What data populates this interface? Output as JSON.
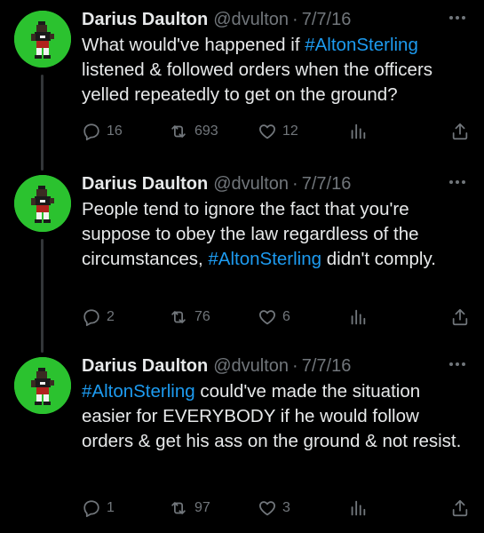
{
  "colors": {
    "background": "#000000",
    "text": "#e7e9ea",
    "muted": "#71767b",
    "link": "#1d9bf0",
    "avatar_bg": "#2bc22f",
    "thread_line": "#333639"
  },
  "tweets": [
    {
      "name": "Darius Daulton",
      "handle": "@dvulton",
      "separator": "·",
      "date": "7/7/16",
      "text_parts": [
        {
          "text": "What would've happened if ",
          "type": "text"
        },
        {
          "text": "#AltonSterling",
          "type": "hashtag"
        },
        {
          "text": " listened & followed orders when the officers yelled repeatedly to get on the ground?",
          "type": "text"
        }
      ],
      "replies": "16",
      "retweets": "693",
      "likes": "12"
    },
    {
      "name": "Darius Daulton",
      "handle": "@dvulton",
      "separator": "·",
      "date": "7/7/16",
      "text_parts": [
        {
          "text": "People tend to ignore the fact that you're suppose to obey the law regardless of the circumstances, ",
          "type": "text"
        },
        {
          "text": "#AltonSterling",
          "type": "hashtag"
        },
        {
          "text": " didn't comply.",
          "type": "text"
        }
      ],
      "replies": "2",
      "retweets": "76",
      "likes": "6"
    },
    {
      "name": "Darius Daulton",
      "handle": "@dvulton",
      "separator": "·",
      "date": "7/7/16",
      "text_parts": [
        {
          "text": "#AltonSterling",
          "type": "hashtag"
        },
        {
          "text": " could've made the situation easier for EVERYBODY if he would follow orders & get his ass on the ground & not resist.",
          "type": "text"
        }
      ],
      "replies": "1",
      "retweets": "97",
      "likes": "3"
    }
  ],
  "icons": {
    "reply": "reply-icon",
    "retweet": "retweet-icon",
    "like": "heart-icon",
    "views": "views-chart-icon",
    "share": "share-icon",
    "more": "more-options-icon"
  }
}
